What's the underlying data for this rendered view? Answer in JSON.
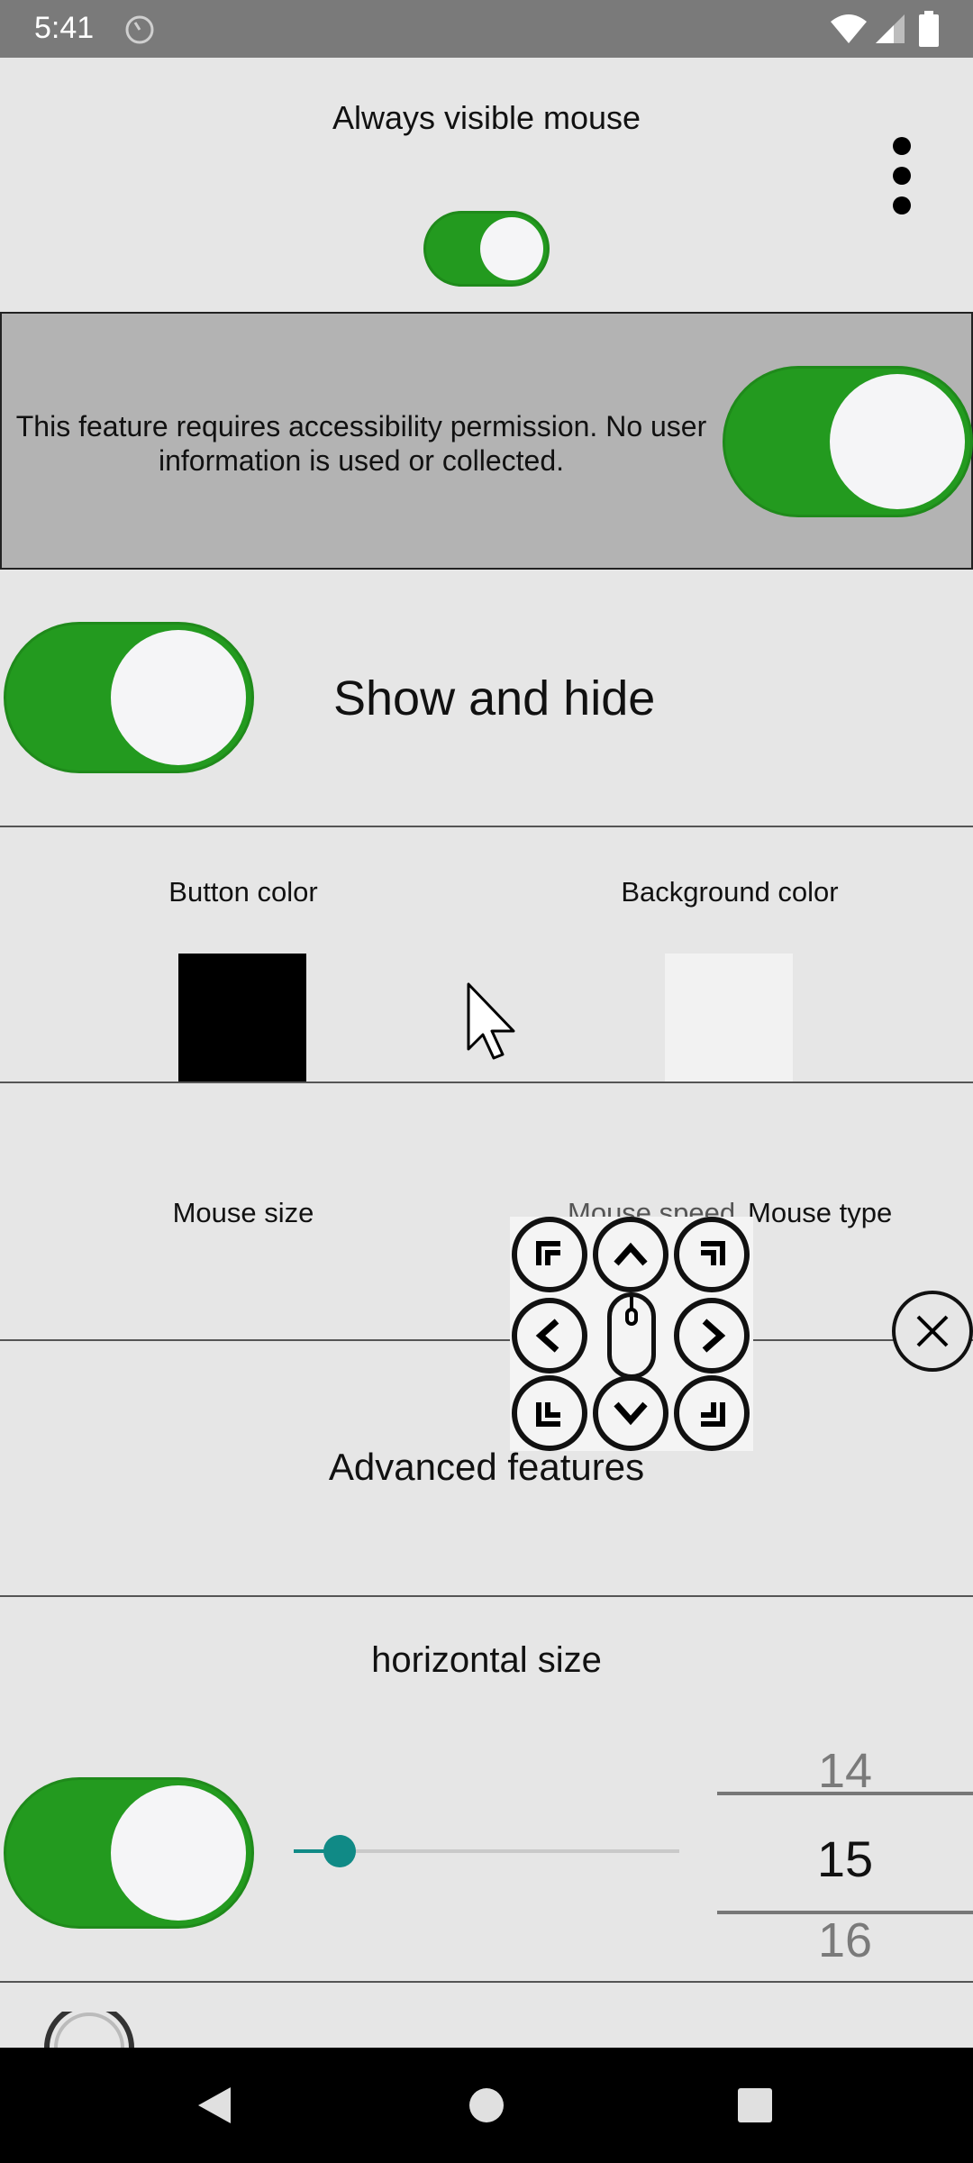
{
  "status_bar": {
    "time": "5:41",
    "icons": [
      "clock-icon",
      "wifi-icon",
      "signal-icon",
      "battery-icon"
    ]
  },
  "header": {
    "title": "Always visible mouse",
    "toggle_on": true,
    "menu_icon": "more-vertical-icon"
  },
  "permission": {
    "text": "This feature requires accessibility permission. No user information is used or collected.",
    "toggle_on": true
  },
  "show_hide": {
    "label": "Show and hide",
    "toggle_on": true
  },
  "colors": {
    "button_color_label": "Button color",
    "background_color_label": "Background color",
    "button_color": "#000000",
    "background_color": "#f2f2f2"
  },
  "mouse_settings": {
    "size_label": "Mouse size",
    "speed_label": "Mouse speed",
    "type_label": "Mouse type"
  },
  "advanced": {
    "label": "Advanced features"
  },
  "horizontal_size": {
    "label": "horizontal size",
    "toggle_on": true,
    "slider_fraction": 0.12,
    "picker_prev": "14",
    "picker_current": "15",
    "picker_next": "16"
  },
  "theme": {
    "accent_green": "#239a1f",
    "slider_teal": "#108a86"
  },
  "nav_bar": {
    "icons": [
      "back-icon",
      "home-icon",
      "recents-icon"
    ]
  }
}
